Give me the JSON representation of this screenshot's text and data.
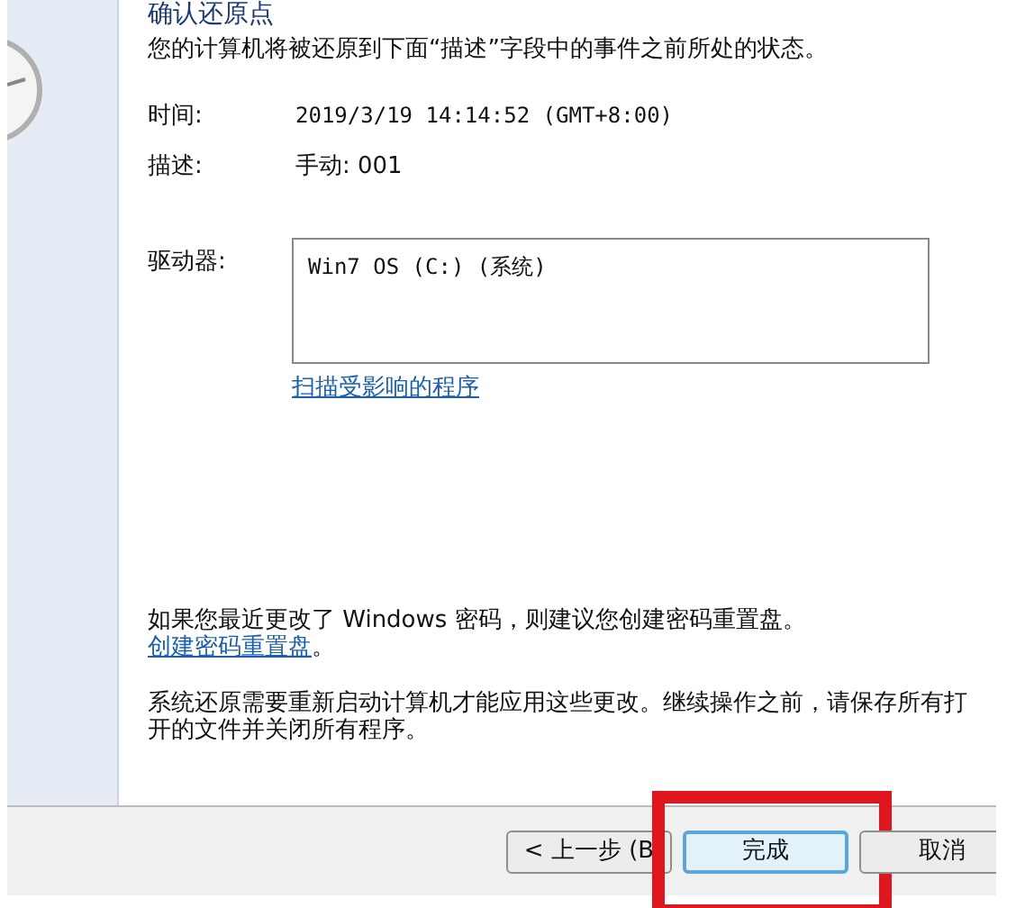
{
  "title": "确认还原点",
  "intro": "您的计算机将被还原到下面“描述”字段中的事件之前所处的状态。",
  "fields": [
    {
      "label": "时间:",
      "value": "2019/3/19 14:14:52 (GMT+8:00)"
    },
    {
      "label": "描述:",
      "value": "手动: 001"
    }
  ],
  "drives": {
    "label": "驱动器:",
    "items": [
      "Win7 OS (C:) (系统)"
    ]
  },
  "scan_link": "扫描受影响的程序",
  "password_note": {
    "text": "如果您最近更改了 Windows 密码，则建议您创建密码重置盘。",
    "link": "创建密码重置盘",
    "end": "。"
  },
  "restart_note": "系统还原需要重新启动计算机才能应用这些更改。继续操作之前，请保存所有打开的文件并关闭所有程序。",
  "buttons": [
    {
      "label": "< 上一步 (B",
      "default": false,
      "highlighted": false
    },
    {
      "label": "完成",
      "default": true,
      "highlighted": true
    },
    {
      "label": "取消",
      "default": false,
      "highlighted": false
    }
  ]
}
